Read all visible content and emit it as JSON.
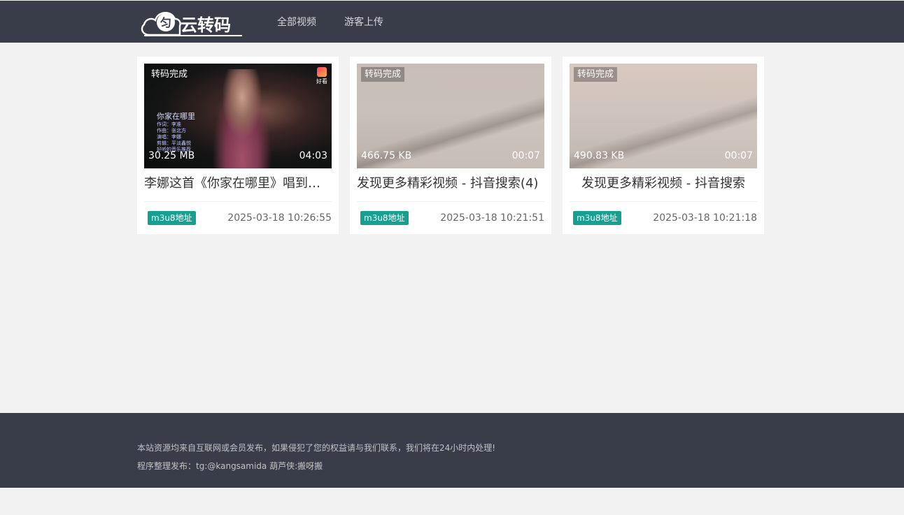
{
  "header": {
    "logo_text": "云转码",
    "nav": [
      "全部视频",
      "游客上传"
    ]
  },
  "videos": [
    {
      "status": "转码完成",
      "size": "30.25 MB",
      "duration": "04:03",
      "title": "李娜这首《你家在哪里》唱到了心里，令人动容",
      "tag": "m3u8地址",
      "date": "2025-03-18 10:26:55",
      "overlay": {
        "heading": "你家在哪里",
        "lines": [
          "作词：李准",
          "作曲：张北方",
          "演唱：李娜",
          "剪辑：平淡鑫悦",
          "好听的音乐推荐"
        ],
        "app_label": "好看"
      }
    },
    {
      "status": "转码完成",
      "size": "466.75 KB",
      "duration": "00:07",
      "title": "发现更多精彩视频 - 抖音搜索(4)",
      "tag": "m3u8地址",
      "date": "2025-03-18 10:21:51"
    },
    {
      "status": "转码完成",
      "size": "490.83 KB",
      "duration": "00:07",
      "title": "发现更多精彩视频 - 抖音搜索",
      "tag": "m3u8地址",
      "date": "2025-03-18 10:21:18"
    }
  ],
  "footer": {
    "line1": "本站资源均来自互联网或会员发布，如果侵犯了您的权益请与我们联系，我们将在24小时内处理!",
    "line2": "程序整理发布：tg:@kangsamida 葫芦侠:搬呀搬"
  },
  "colors": {
    "header_bg": "#393d49",
    "tag_bg": "#16a092",
    "page_bg": "#f2f2f2"
  }
}
